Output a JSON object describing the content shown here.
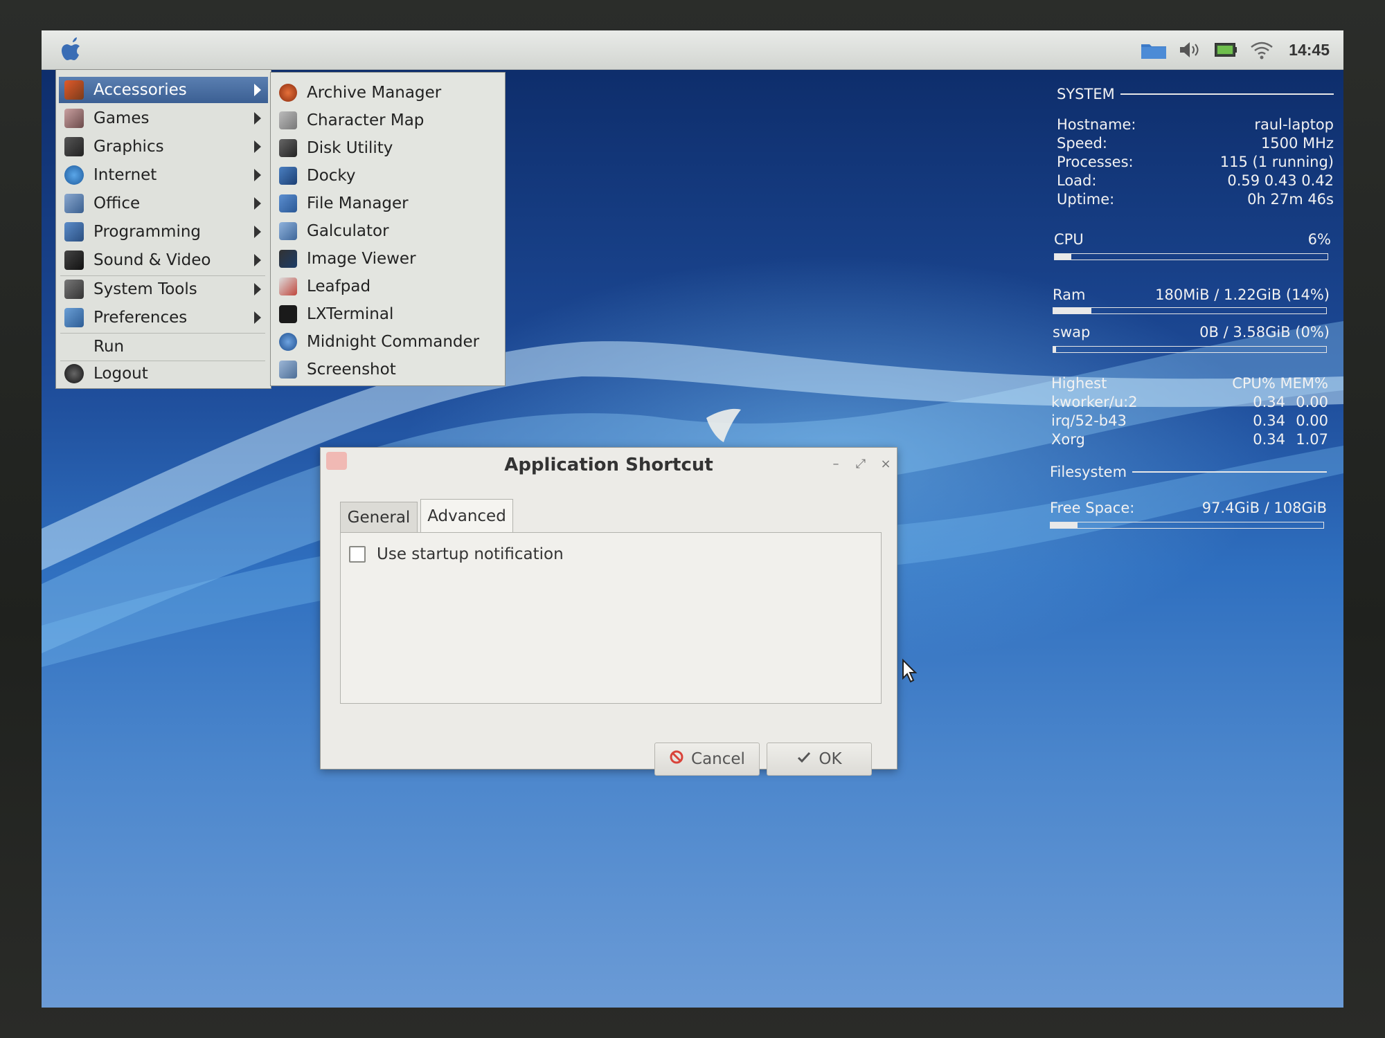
{
  "panel": {
    "clock": "14:45",
    "tray_icons": [
      "folder-icon",
      "volume-icon",
      "battery-icon",
      "wifi-icon"
    ]
  },
  "menu": {
    "items": [
      {
        "label": "Accessories",
        "icon": "accessories-icon",
        "submenu": true,
        "selected": true
      },
      {
        "label": "Games",
        "icon": "games-icon",
        "submenu": true
      },
      {
        "label": "Graphics",
        "icon": "graphics-icon",
        "submenu": true
      },
      {
        "label": "Internet",
        "icon": "internet-icon",
        "submenu": true
      },
      {
        "label": "Office",
        "icon": "office-icon",
        "submenu": true
      },
      {
        "label": "Programming",
        "icon": "programming-icon",
        "submenu": true
      },
      {
        "label": "Sound & Video",
        "icon": "sound-video-icon",
        "submenu": true
      },
      {
        "label": "System Tools",
        "icon": "system-tools-icon",
        "submenu": true
      },
      {
        "label": "Preferences",
        "icon": "preferences-icon",
        "submenu": true
      },
      {
        "label": "Run",
        "icon": "",
        "submenu": false
      },
      {
        "label": "Logout",
        "icon": "logout-icon",
        "submenu": false
      }
    ]
  },
  "submenu": {
    "items": [
      {
        "label": "Archive Manager",
        "icon": "archive-manager-icon"
      },
      {
        "label": "Character Map",
        "icon": "character-map-icon"
      },
      {
        "label": "Disk Utility",
        "icon": "disk-utility-icon"
      },
      {
        "label": "Docky",
        "icon": "docky-icon"
      },
      {
        "label": "File Manager",
        "icon": "file-manager-icon"
      },
      {
        "label": "Galculator",
        "icon": "galculator-icon"
      },
      {
        "label": "Image Viewer",
        "icon": "image-viewer-icon"
      },
      {
        "label": "Leafpad",
        "icon": "leafpad-icon"
      },
      {
        "label": "LXTerminal",
        "icon": "lxterminal-icon"
      },
      {
        "label": "Midnight Commander",
        "icon": "midnight-commander-icon"
      },
      {
        "label": "Screenshot",
        "icon": "screenshot-icon"
      }
    ]
  },
  "conky": {
    "system_header": "SYSTEM",
    "rows": [
      {
        "k": "Hostname:",
        "v": "raul-laptop"
      },
      {
        "k": "Speed:",
        "v": "1500 MHz"
      },
      {
        "k": "Processes:",
        "v": "115 (1 running)"
      },
      {
        "k": "Load:",
        "v": "0.59 0.43 0.42"
      },
      {
        "k": "Uptime:",
        "v": "0h 27m 46s"
      }
    ],
    "cpu_label": "CPU",
    "cpu_value": "6%",
    "cpu_fraction": 0.06,
    "ram_label": "Ram",
    "ram_value": "180MiB / 1.22GiB (14%)",
    "ram_fraction": 0.14,
    "swap_label": "swap",
    "swap_value": "0B / 3.58GiB (0%)",
    "swap_fraction": 0.0,
    "highest_label": "Highest",
    "highest_cols": "CPU% MEM%",
    "procs": [
      {
        "name": "kworker/u:2",
        "cpu": "0.34",
        "mem": "0.00"
      },
      {
        "name": "irq/52-b43",
        "cpu": "0.34",
        "mem": "0.00"
      },
      {
        "name": "Xorg",
        "cpu": "0.34",
        "mem": "1.07"
      }
    ],
    "fs_header": "Filesystem",
    "free_label": "Free Space:",
    "free_value": "97.4GiB / 108GiB",
    "free_fraction": 0.1
  },
  "dialog": {
    "title": "Application Shortcut",
    "tabs": [
      "General",
      "Advanced"
    ],
    "active_tab": "Advanced",
    "checkbox_label": "Use startup notification",
    "checkbox_checked": false,
    "cancel_label": "Cancel",
    "ok_label": "OK"
  }
}
